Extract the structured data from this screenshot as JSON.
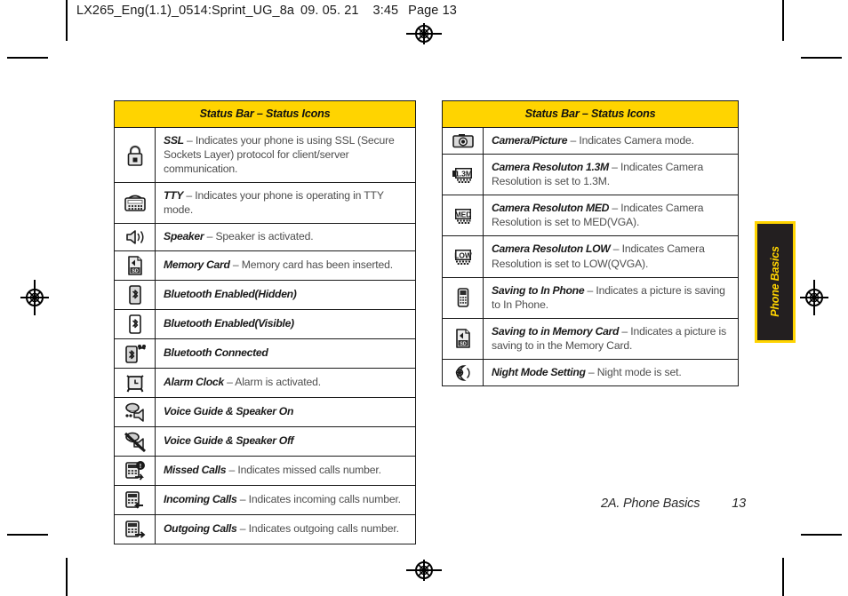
{
  "slug": {
    "file": "LX265_Eng(1.1)_0514:Sprint_UG_8a",
    "date": "09. 05. 21",
    "time": "3:45",
    "page_label": "Page 13"
  },
  "tables": [
    {
      "header": "Status Bar – Status Icons",
      "rows": [
        {
          "icon": "padlock-icon",
          "term": "SSL",
          "dash": " – ",
          "desc": "Indicates your phone is using SSL (Secure Sockets Layer) protocol for client/server communication."
        },
        {
          "icon": "tty-device-icon",
          "term": "TTY",
          "dash": " – ",
          "desc": "Indicates your phone is operating in TTY mode."
        },
        {
          "icon": "speaker-icon",
          "term": "Speaker",
          "dash": " – ",
          "desc": "Speaker is activated."
        },
        {
          "icon": "memory-card-icon",
          "term": "Memory Card",
          "dash": " – ",
          "desc": "Memory card has been inserted."
        },
        {
          "icon": "bluetooth-hidden-icon",
          "term": "Bluetooth Enabled(Hidden)",
          "dash": "",
          "desc": ""
        },
        {
          "icon": "bluetooth-visible-icon",
          "term": "Bluetooth Enabled(Visible)",
          "dash": "",
          "desc": ""
        },
        {
          "icon": "bluetooth-connected-icon",
          "term": "Bluetooth Connected",
          "dash": "",
          "desc": ""
        },
        {
          "icon": "alarm-clock-icon",
          "term": "Alarm Clock",
          "dash": " – ",
          "desc": "Alarm is activated."
        },
        {
          "icon": "voice-guide-speaker-on-icon",
          "term": "Voice Guide & Speaker On",
          "dash": "",
          "desc": ""
        },
        {
          "icon": "voice-guide-speaker-off-icon",
          "term": "Voice Guide & Speaker Off",
          "dash": "",
          "desc": ""
        },
        {
          "icon": "missed-calls-icon",
          "term": "Missed Calls",
          "dash": " – ",
          "desc": "Indicates missed calls number."
        },
        {
          "icon": "incoming-calls-icon",
          "term": "Incoming Calls",
          "dash": " – ",
          "desc": "Indicates incoming calls number."
        },
        {
          "icon": "outgoing-calls-icon",
          "term": "Outgoing Calls",
          "dash": " – ",
          "desc": "Indicates outgoing calls number."
        }
      ]
    },
    {
      "header": "Status Bar – Status Icons",
      "rows": [
        {
          "icon": "camera-icon",
          "term": "Camera/Picture",
          "dash": " – ",
          "desc": "Indicates Camera mode."
        },
        {
          "icon": "camera-resolution-1-3m-icon",
          "term": "Camera Resoluton 1.3M",
          "dash": " – ",
          "desc": "Indicates Camera Resolution is set to 1.3M."
        },
        {
          "icon": "camera-resolution-med-icon",
          "term": "Camera Resoluton MED",
          "dash": " – ",
          "desc": "Indicates Camera Resolution is set to MED(VGA)."
        },
        {
          "icon": "camera-resolution-low-icon",
          "term": "Camera Resoluton LOW",
          "dash": " – ",
          "desc": "Indicates Camera Resolution is set to LOW(QVGA)."
        },
        {
          "icon": "saving-to-phone-icon",
          "term": "Saving to In Phone",
          "dash": " – ",
          "desc": "Indicates a picture is saving to In Phone."
        },
        {
          "icon": "saving-to-memory-card-icon",
          "term": "Saving to in Memory Card",
          "dash": " – ",
          "desc": "Indicates a picture is saving to in the Memory Card."
        },
        {
          "icon": "night-mode-icon",
          "term": "Night Mode Setting",
          "dash": " – ",
          "desc": "Night mode is set."
        }
      ]
    }
  ],
  "side_tab": {
    "label": "Phone Basics"
  },
  "footer": {
    "chapter": "2A. Phone Basics",
    "page_number": "13"
  },
  "colors": {
    "header_yellow": "#ffd400",
    "tab_black": "#231f20",
    "rule_black": "#1a1a1a",
    "body_gray": "#4d4d4d"
  }
}
